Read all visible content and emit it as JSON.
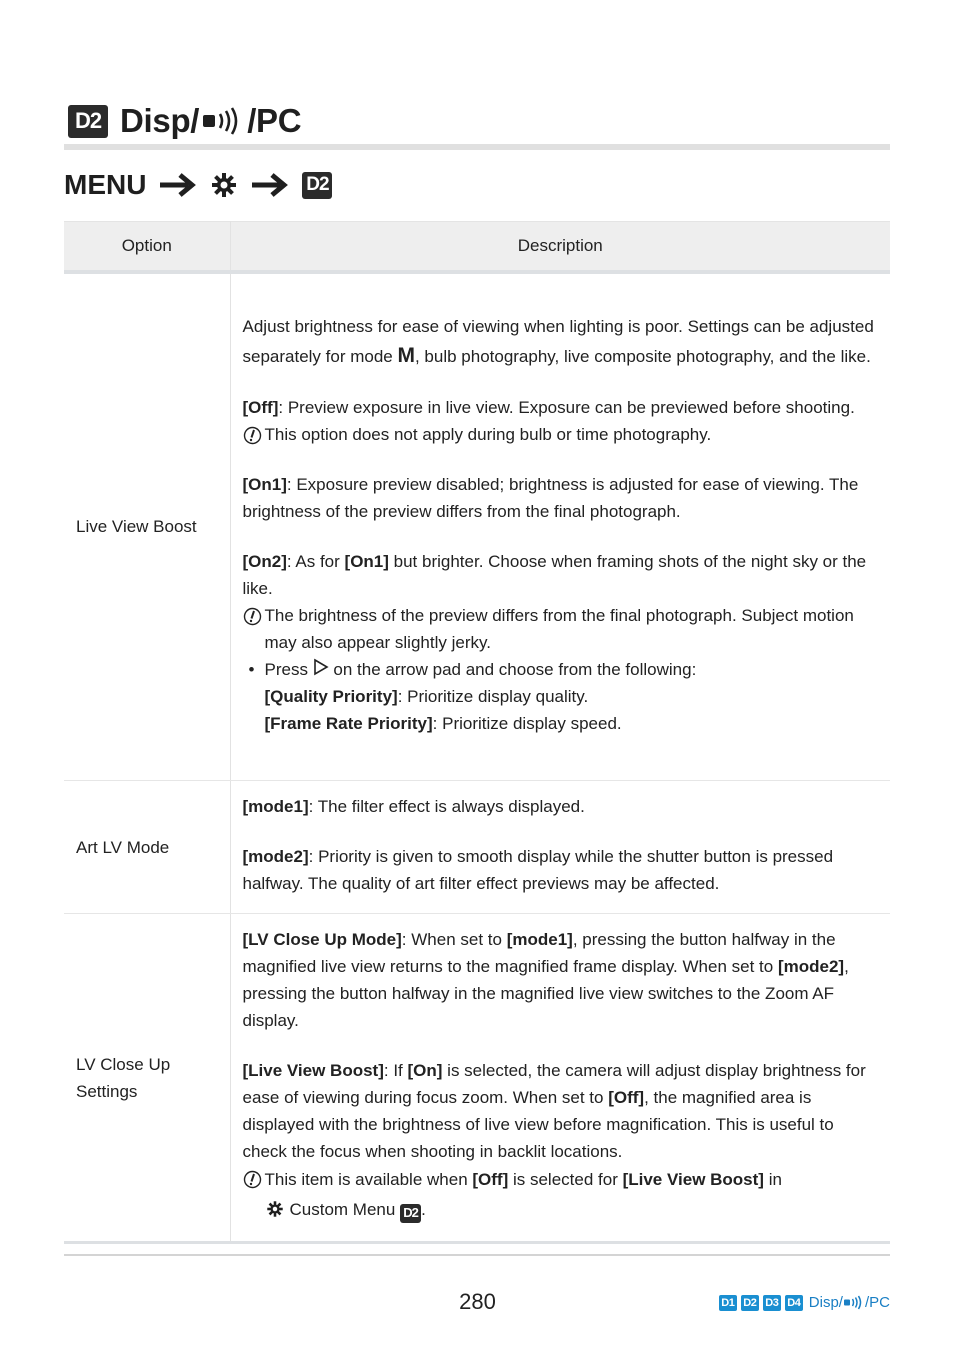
{
  "header": {
    "badge": "D2",
    "title_prefix": "Disp/",
    "title_icon": "wireless-icon",
    "title_suffix": "/PC"
  },
  "menu_path": {
    "menu_label": "MENU",
    "arrow_icon": "arrow-right-icon",
    "custom_icon": "gear-icon",
    "badge": "D2"
  },
  "table": {
    "headers": {
      "option": "Option",
      "description": "Description"
    },
    "rows": [
      {
        "option": "Live View Boost",
        "intro_a": "Adjust brightness for ease of viewing when lighting is poor. Settings can be adjusted separately for mode ",
        "intro_mode": "M",
        "intro_b": ", bulb photography, live composite photography, and the like.",
        "off_key": "[Off]",
        "off_text": ": Preview exposure in live view. Exposure can be previewed before shooting.",
        "off_note": "This option does not apply during bulb or time photography.",
        "on1_key": "[On1]",
        "on1_text": ": Exposure preview disabled; brightness is adjusted for ease of viewing. The brightness of the preview differs from the final photograph.",
        "on2_key": "[On2]",
        "on2_text_a": ": As for ",
        "on2_ref": "[On1]",
        "on2_text_b": " but brighter. Choose when framing shots of the night sky or the like.",
        "on2_note": "The brightness of the preview differs from the final photograph. Subject motion may also appear slightly jerky.",
        "bullet_a": "Press ",
        "bullet_icon": "arrow-pad-right-icon",
        "bullet_b": " on the arrow pad and choose from the following:",
        "sub1_key": "[Quality Priority]",
        "sub1_text": ": Prioritize display quality.",
        "sub2_key": "[Frame Rate Priority]",
        "sub2_text": ": Prioritize display speed."
      },
      {
        "option": "Art LV Mode",
        "mode1_key": "[mode1]",
        "mode1_text": ": The filter effect is always displayed.",
        "mode2_key": "[mode2]",
        "mode2_text": ": Priority is given to smooth display while the shutter button is pressed halfway. The quality of art filter effect previews may be affected."
      },
      {
        "option": "LV Close Up Settings",
        "lvc_key": "[LV Close Up Mode]",
        "lvc_a": ": When set to ",
        "lvc_mode1": "[mode1]",
        "lvc_b": ", pressing the button halfway in the magnified live view returns to the magnified frame display. When set to ",
        "lvc_mode2": "[mode2]",
        "lvc_c": ", pressing the button halfway in the magnified live view switches to the Zoom AF display.",
        "lvb_key": "[Live View Boost]",
        "lvb_a": ": If ",
        "lvb_on": "[On]",
        "lvb_b": " is selected, the camera will adjust display brightness for ease of viewing during focus zoom. When set to ",
        "lvb_off": "[Off]",
        "lvb_c": ", the magnified area is displayed with the brightness of live view before magnification. This is useful to check the focus when shooting in backlit locations.",
        "note_a": "This item is available when ",
        "note_off": "[Off]",
        "note_b": " is selected for ",
        "note_lvb": "[Live View Boost]",
        "note_c": " in",
        "note_menu": "Custom Menu",
        "note_badge": "D2",
        "note_end": "."
      }
    ]
  },
  "footer": {
    "page_number": "280",
    "nav_tabs": [
      "D1",
      "D2",
      "D3",
      "D4"
    ],
    "nav_prefix": "Disp/",
    "nav_suffix": "/PC",
    "accent_color": "#1a8fd1"
  }
}
